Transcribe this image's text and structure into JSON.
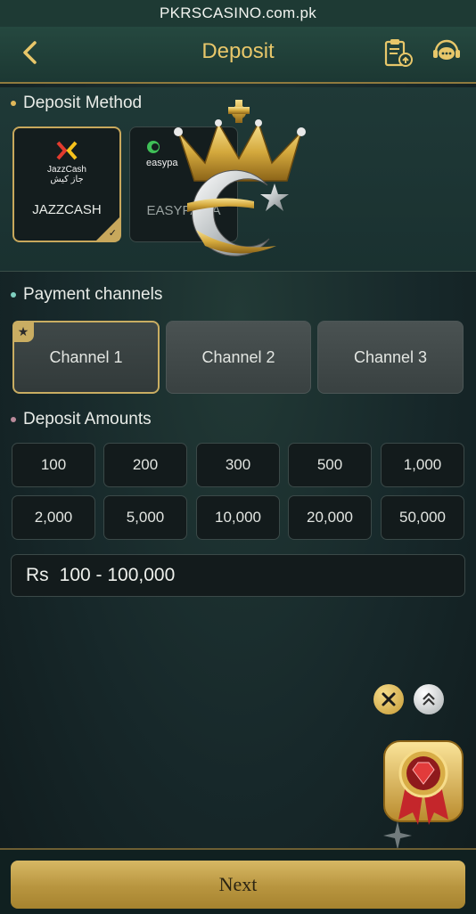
{
  "url_bar": {
    "text": "PKRSCASINO.com.pk"
  },
  "header": {
    "title": "Deposit",
    "back_icon": "chevron-left-icon",
    "history_icon": "clipboard-upload-icon",
    "support_icon": "chat-support-icon"
  },
  "colors": {
    "gold": "#c9ad62",
    "title_gold": "#e8c76a",
    "dark_field": "#131b1c",
    "header_bg": "#25483f"
  },
  "deposit_method": {
    "label": "Deposit Method",
    "methods": [
      {
        "name": "JAZZCASH",
        "logo_text": "JazzCash",
        "logo_sub": "جاز کیش",
        "selected": true
      },
      {
        "name": "EASYPAISA",
        "logo_text": "easypa",
        "selected": false
      }
    ]
  },
  "payment_channels": {
    "label": "Payment channels",
    "channels": [
      {
        "label": "Channel 1",
        "selected": true
      },
      {
        "label": "Channel 2",
        "selected": false
      },
      {
        "label": "Channel 3",
        "selected": false
      }
    ]
  },
  "deposit_amounts": {
    "label": "Deposit Amounts",
    "options": [
      "100",
      "200",
      "300",
      "500",
      "1,000",
      "2,000",
      "5,000",
      "10,000",
      "20,000",
      "50,000"
    ],
    "currency": "Rs",
    "range": "100 - 100,000"
  },
  "next_button": {
    "label": "Next"
  }
}
